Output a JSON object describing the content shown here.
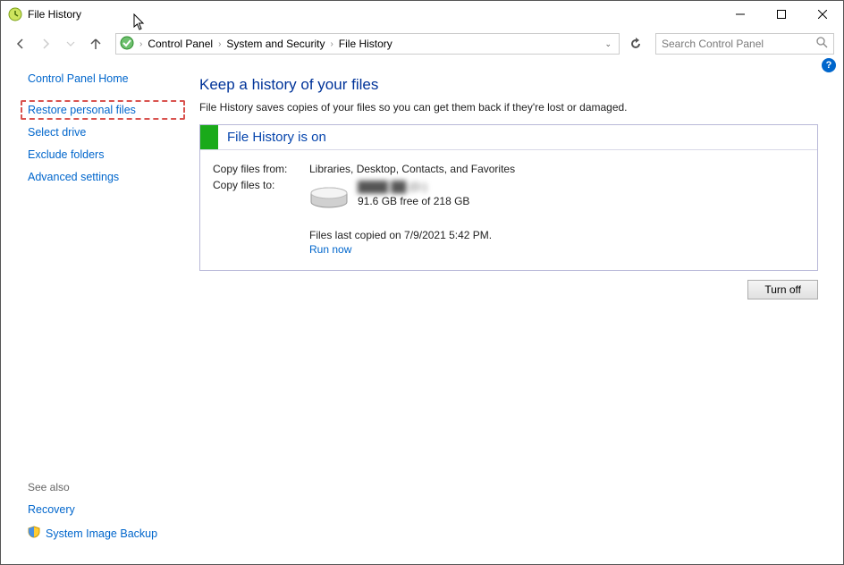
{
  "titlebar": {
    "title": "File History"
  },
  "breadcrumbs": {
    "items": [
      "Control Panel",
      "System and Security",
      "File History"
    ]
  },
  "search": {
    "placeholder": "Search Control Panel"
  },
  "sidebar": {
    "home": "Control Panel Home",
    "links": {
      "restore": "Restore personal files",
      "select_drive": "Select drive",
      "exclude": "Exclude folders",
      "advanced": "Advanced settings"
    },
    "see_also": "See also",
    "recovery": "Recovery",
    "sys_image_backup": "System Image Backup"
  },
  "main": {
    "heading": "Keep a history of your files",
    "subtext": "File History saves copies of your files so you can get them back if they're lost or damaged.",
    "status_title": "File History is on",
    "copy_from_label": "Copy files from:",
    "copy_from_value": "Libraries, Desktop, Contacts, and Favorites",
    "copy_to_label": "Copy files to:",
    "drive_name": "████ ██ (D:)",
    "drive_free": "91.6 GB free of 218 GB",
    "last_copied": "Files last copied on 7/9/2021 5:42 PM.",
    "run_now": "Run now",
    "turn_off": "Turn off"
  }
}
